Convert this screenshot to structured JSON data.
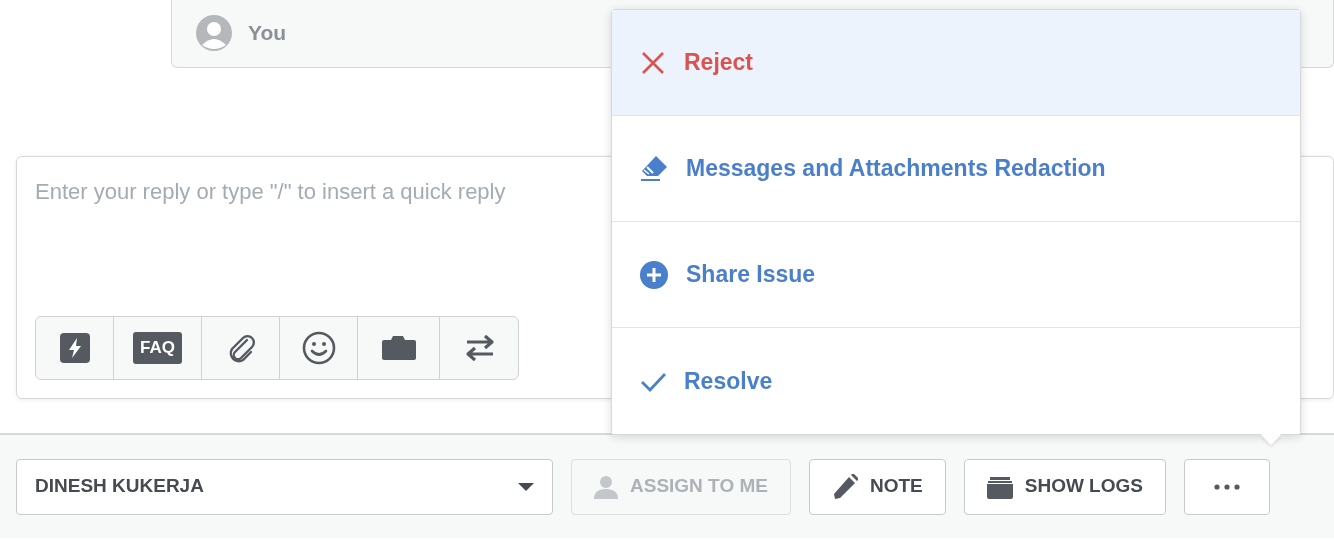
{
  "message": {
    "author": "You"
  },
  "reply": {
    "placeholder": "Enter your reply or type \"/\" to insert a quick reply"
  },
  "toolbar": [
    {
      "kind": "bolt"
    },
    {
      "kind": "text",
      "label": "FAQ"
    },
    {
      "kind": "clip"
    },
    {
      "kind": "smile"
    },
    {
      "kind": "folder"
    },
    {
      "kind": "swap"
    }
  ],
  "menu": {
    "expanded": true,
    "items": [
      {
        "kind": "reject",
        "label": "Reject",
        "color": "#d9534f",
        "highlighted": true
      },
      {
        "kind": "redact",
        "label": "Messages and Attachments Redaction",
        "color": "#4a7fcb",
        "highlighted": false
      },
      {
        "kind": "share",
        "label": "Share Issue",
        "color": "#4a7fcb",
        "highlighted": false
      },
      {
        "kind": "resolve",
        "label": "Resolve",
        "color": "#4a7fcb",
        "highlighted": false
      }
    ]
  },
  "footer": {
    "assignee": "DINESH KUKERJA",
    "buttons": [
      {
        "kind": "assign",
        "label": "ASSIGN TO ME",
        "disabled": true
      },
      {
        "kind": "note",
        "label": "NOTE",
        "disabled": false
      },
      {
        "kind": "logs",
        "label": "SHOW LOGS",
        "disabled": false
      },
      {
        "kind": "more",
        "disabled": false
      }
    ]
  }
}
